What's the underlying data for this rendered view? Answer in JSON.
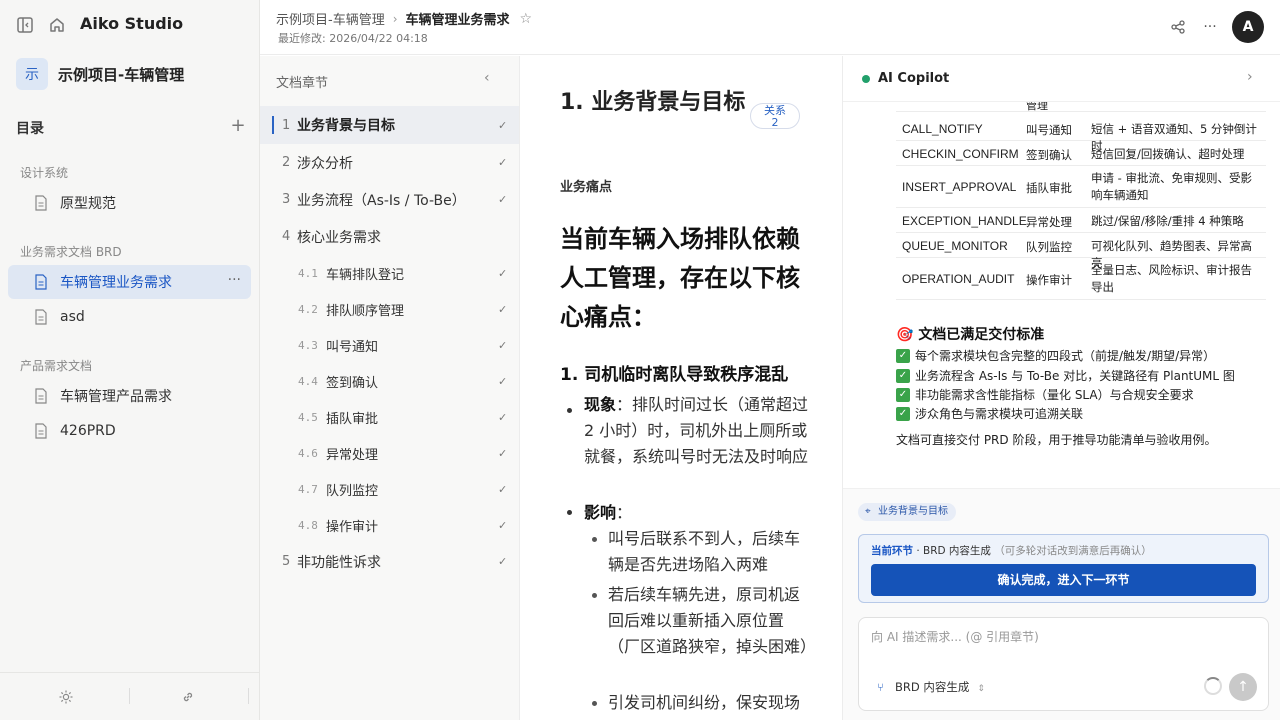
{
  "app": {
    "name": "Aiko Studio"
  },
  "sidebar": {
    "project_badge": "示",
    "project_name": "示例项目-车辆管理",
    "toc_heading": "目录",
    "groups": [
      {
        "label": "设计系统",
        "items": [
          {
            "label": "原型规范"
          }
        ]
      },
      {
        "label": "业务需求文档 BRD",
        "items": [
          {
            "label": "车辆管理业务需求",
            "active": true
          },
          {
            "label": "asd"
          }
        ]
      },
      {
        "label": "产品需求文档",
        "items": [
          {
            "label": "车辆管理产品需求"
          },
          {
            "label": "426PRD"
          }
        ]
      }
    ]
  },
  "header": {
    "breadcrumb_project": "示例项目-车辆管理",
    "breadcrumb_current": "车辆管理业务需求",
    "modified": "最近修改: 2026/04/22 04:18",
    "avatar": "A"
  },
  "chapters": {
    "title": "文档章节",
    "items": [
      {
        "num": "1",
        "label": "业务背景与目标",
        "done": true,
        "active": true
      },
      {
        "num": "2",
        "label": "涉众分析",
        "done": true
      },
      {
        "num": "3",
        "label": "业务流程（As-Is / To-Be）",
        "done": true
      },
      {
        "num": "4",
        "label": "核心业务需求",
        "done": false
      },
      {
        "num": "4.1",
        "label": "车辆排队登记",
        "done": true
      },
      {
        "num": "4.2",
        "label": "排队顺序管理",
        "done": true
      },
      {
        "num": "4.3",
        "label": "叫号通知",
        "done": true
      },
      {
        "num": "4.4",
        "label": "签到确认",
        "done": true
      },
      {
        "num": "4.5",
        "label": "插队审批",
        "done": true
      },
      {
        "num": "4.6",
        "label": "异常处理",
        "done": true
      },
      {
        "num": "4.7",
        "label": "队列监控",
        "done": true
      },
      {
        "num": "4.8",
        "label": "操作审计",
        "done": true
      },
      {
        "num": "5",
        "label": "非功能性诉求",
        "done": true
      }
    ]
  },
  "document": {
    "title": "1. 业务背景与目标",
    "relations_label": "关系",
    "relations_count": "2",
    "section_label": "业务痛点",
    "big_heading": "当前车辆入场排队依赖人工管理，存在以下核心痛点：",
    "subheading": "1. 司机临时离队导致秩序混乱",
    "phenomenon_label": "现象",
    "phenomenon_text": "：排队时间过长（通常超过 2 小时）时，司机外出上厕所或就餐，系统叫号时无法及时响应",
    "impact_label": "影响",
    "impact_colon": "：",
    "impacts": [
      "叫号后联系不到人，后续车辆是否先进场陷入两难",
      "若后续车辆先进，原司机返回后难以重新插入原位置（厂区道路狭窄，掉头困难）",
      "引发司机间纠纷，保安现场"
    ]
  },
  "copilot": {
    "title": "AI Copilot",
    "partial_cell": "管理",
    "table_rows": [
      {
        "code": "CALL_NOTIFY",
        "name": "叫号通知",
        "desc": "短信 + 语音双通知、5 分钟倒计时"
      },
      {
        "code": "CHECKIN_CONFIRM",
        "name": "签到确认",
        "desc": "短信回复/回拨确认、超时处理"
      },
      {
        "code": "INSERT_APPROVAL",
        "name": "插队审批",
        "desc": "申请 - 审批流、免审规则、受影响车辆通知"
      },
      {
        "code": "EXCEPTION_HANDLE",
        "name": "异常处理",
        "desc": "跳过/保留/移除/重排 4 种策略"
      },
      {
        "code": "QUEUE_MONITOR",
        "name": "队列监控",
        "desc": "可视化队列、趋势图表、异常高亮"
      },
      {
        "code": "OPERATION_AUDIT",
        "name": "操作审计",
        "desc": "全量日志、风险标识、审计报告导出"
      }
    ],
    "deliverable_icon": "🎯",
    "deliverable_heading": "文档已满足交付标准",
    "checklist": [
      "每个需求模块包含完整的四段式（前提/触发/期望/异常）",
      "业务流程含 As-Is 与 To-Be 对比，关键路径有 PlantUML 图",
      "非功能需求含性能指标（量化 SLA）与合规安全要求",
      "涉众角色与需求模块可追溯关联"
    ],
    "footer_note": "文档可直接交付 PRD 阶段，用于推导功能清单与验收用例。",
    "context_chip": "业务背景与目标",
    "stage_label": "当前环节",
    "stage_name": " · BRD 内容生成",
    "stage_hint": "（可多轮对话改到满意后再确认）",
    "confirm_button": "确认完成，进入下一环节",
    "input_placeholder": "向 AI 描述需求... (@ 引用章节)",
    "mode_label": "BRD 内容生成"
  }
}
